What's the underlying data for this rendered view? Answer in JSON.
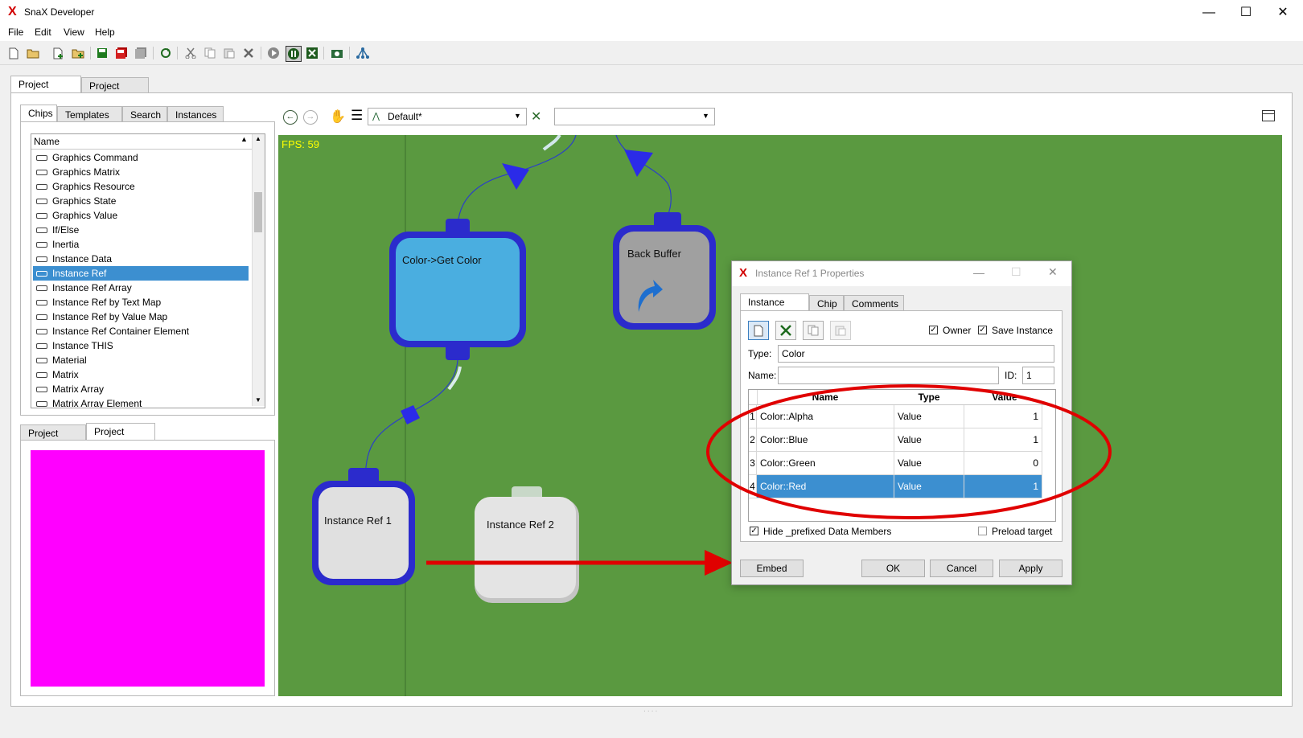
{
  "window": {
    "title": "SnaX Developer",
    "logo": "X",
    "minimize": "—",
    "maximize": "☐",
    "close": "✕"
  },
  "menu": [
    "File",
    "Edit",
    "View",
    "Help"
  ],
  "main_tabs": [
    "Project Editor",
    "Project View"
  ],
  "left_tabs": [
    "Chips",
    "Templates",
    "Search",
    "Instances"
  ],
  "chip_list": {
    "header": "Name",
    "items": [
      "Graphics Command",
      "Graphics Matrix",
      "Graphics Resource",
      "Graphics State",
      "Graphics Value",
      "If/Else",
      "Inertia",
      "Instance Data",
      "Instance Ref",
      "Instance Ref Array",
      "Instance Ref by Text Map",
      "Instance Ref by Value Map",
      "Instance Ref Container Element",
      "Instance THIS",
      "Material",
      "Matrix",
      "Matrix Array",
      "Matrix Array Element"
    ],
    "selected": "Instance Ref"
  },
  "bottom_tabs": [
    "Project Tree",
    "Project View"
  ],
  "preview_color": "#ff00ff",
  "canvas": {
    "background": "#5a9940",
    "fps": "FPS: 59",
    "class_select": "Default*",
    "second_select": "",
    "nodes": {
      "get_color": "Color->Get Color",
      "back_buffer": "Back Buffer",
      "ref1": "Instance Ref 1",
      "ref2": "Instance Ref 2"
    }
  },
  "dialog": {
    "title": "Instance Ref 1 Properties",
    "tabs": [
      "Instance Ref",
      "Chip",
      "Comments"
    ],
    "owner_label": "Owner",
    "save_instance_label": "Save Instance",
    "type_label": "Type:",
    "type_value": "Color",
    "name_label": "Name:",
    "name_value": "",
    "id_label": "ID:",
    "id_value": "1",
    "grid": {
      "headers": [
        "Name",
        "Type",
        "Value"
      ],
      "rows": [
        {
          "num": "1",
          "name": "Color::Alpha",
          "type": "Value",
          "value": "1"
        },
        {
          "num": "2",
          "name": "Color::Blue",
          "type": "Value",
          "value": "1"
        },
        {
          "num": "3",
          "name": "Color::Green",
          "type": "Value",
          "value": "0"
        },
        {
          "num": "4",
          "name": "Color::Red",
          "type": "Value",
          "value": "1"
        }
      ],
      "selected_row": "4"
    },
    "hide_prefixed_label": "Hide _prefixed Data Members",
    "preload_label": "Preload target",
    "buttons": {
      "embed": "Embed",
      "ok": "OK",
      "cancel": "Cancel",
      "apply": "Apply"
    }
  },
  "annotation_color": "#e00000"
}
